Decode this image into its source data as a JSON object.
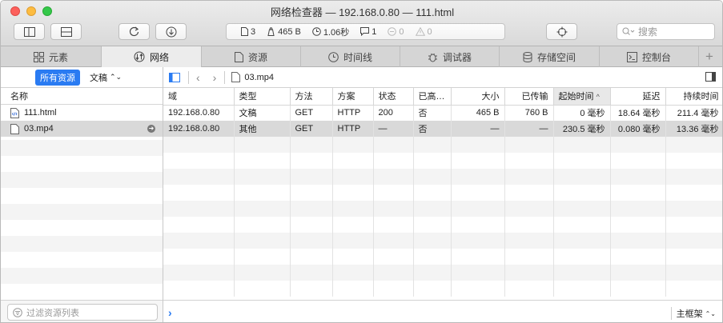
{
  "window": {
    "title": "网络检查器 — 192.168.0.80 — 111.html"
  },
  "toolbar": {
    "stats": {
      "resources": "3",
      "size": "465 B",
      "time": "1.06秒",
      "logs": "1",
      "errors": "0",
      "warnings": "0"
    },
    "search_placeholder": "搜索"
  },
  "tabs": [
    {
      "label": "元素",
      "icon": "elements-icon"
    },
    {
      "label": "网络",
      "icon": "network-icon"
    },
    {
      "label": "资源",
      "icon": "resources-icon"
    },
    {
      "label": "时间线",
      "icon": "timeline-icon"
    },
    {
      "label": "调试器",
      "icon": "debugger-icon"
    },
    {
      "label": "存储空间",
      "icon": "storage-icon"
    },
    {
      "label": "控制台",
      "icon": "console-icon"
    }
  ],
  "sidebar": {
    "filter_all": "所有资源",
    "filter_type": "文稿",
    "header": "名称",
    "items": [
      {
        "name": "111.html"
      },
      {
        "name": "03.mp4"
      }
    ],
    "filter_placeholder": "过滤资源列表"
  },
  "main": {
    "breadcrumb": "03.mp4",
    "columns": [
      "域",
      "类型",
      "方法",
      "方案",
      "状态",
      "已高…",
      "大小",
      "已传输",
      "起始时间",
      "延迟",
      "持续时间"
    ],
    "rows": [
      [
        "192.168.0.80",
        "文稿",
        "GET",
        "HTTP",
        "200",
        "否",
        "465 B",
        "760 B",
        "0 毫秒",
        "18.64 毫秒",
        "211.4 毫秒"
      ],
      [
        "192.168.0.80",
        "其他",
        "GET",
        "HTTP",
        "—",
        "否",
        "—",
        "—",
        "230.5 毫秒",
        "0.080 毫秒",
        "13.36 毫秒"
      ]
    ],
    "console_context": "主框架"
  },
  "colors": {
    "accent": "#2a7bf2",
    "selected_row": "#d9d9d9"
  }
}
